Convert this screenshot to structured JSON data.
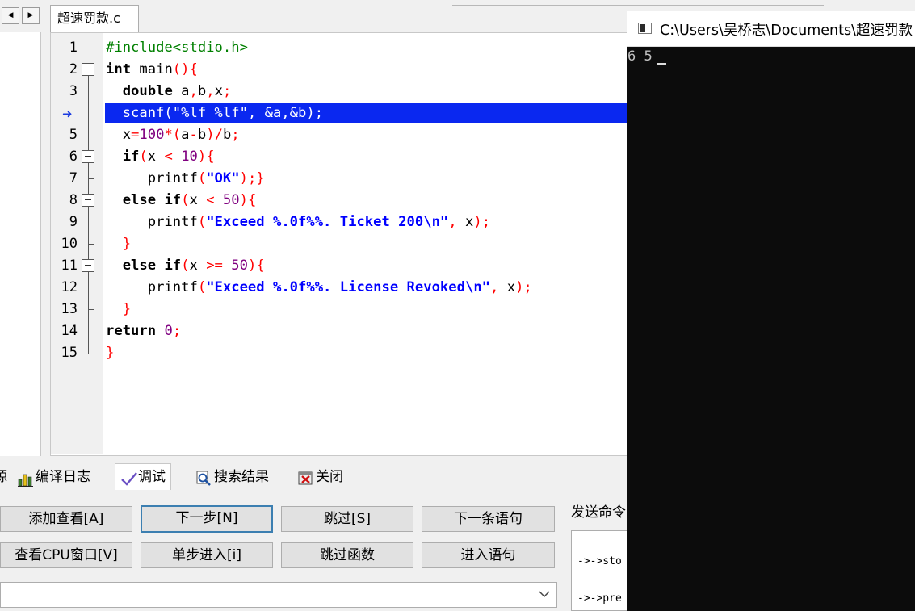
{
  "editor": {
    "file_tab": "超速罚款.c",
    "nav_prev_icon": "◀",
    "nav_next_icon": "▶",
    "breakpoint_icon": "breakpoint-arrow-icon",
    "line_numbers": [
      "1",
      "2",
      "3",
      "",
      "5",
      "6",
      "7",
      "8",
      "9",
      "10",
      "11",
      "12",
      "13",
      "14",
      "15"
    ]
  },
  "bottom_tabs": {
    "partial": "源",
    "compile_log": "编译日志",
    "debug": "调试",
    "search_results": "搜索结果",
    "close": "关闭"
  },
  "debug_panel": {
    "add_watch": "添加查看[A]",
    "next_step": "下一步[N]",
    "skip": "跳过[S]",
    "next_statement": "下一条语句",
    "view_cpu": "查看CPU窗口[V]",
    "step_into": "单步进入[i]",
    "skip_function": "跳过函数",
    "into_statement": "进入语句",
    "send_command_label": "发送命令",
    "send_lines": [
      "->->sto",
      "->->pre"
    ],
    "combo_value": ""
  },
  "console": {
    "title": "C:\\Users\\吴桥志\\Documents\\超速罚款",
    "output": "6 5"
  },
  "colors": {
    "highlight": "#0a28f0",
    "console_bg": "#0c0c0c",
    "preprocessor": "#008000",
    "symbol": "#ff0000",
    "string": "#0000ff"
  }
}
